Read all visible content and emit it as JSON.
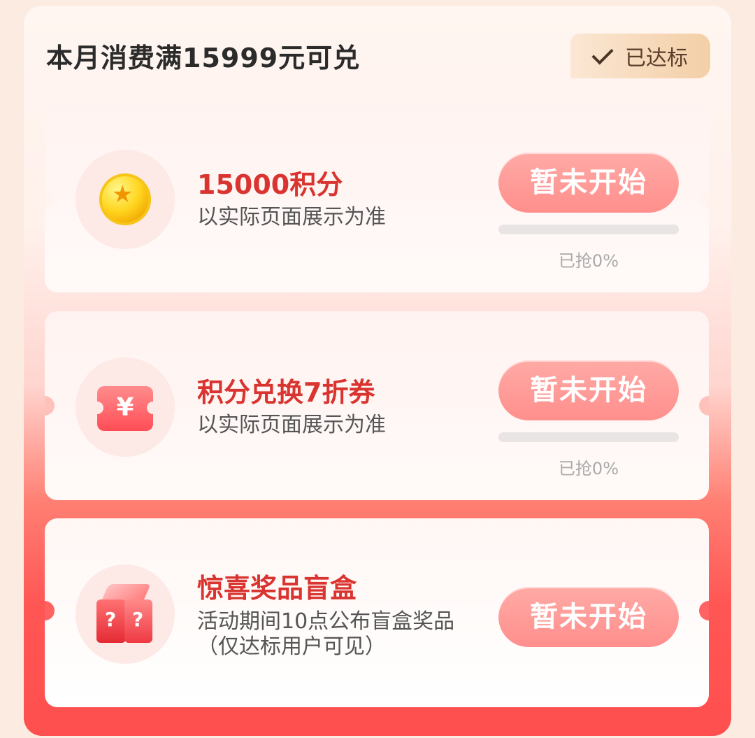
{
  "header": {
    "title": "本月消费满15999元可兑",
    "status_badge": "已达标"
  },
  "rewards": [
    {
      "icon": "coin-icon",
      "title": "15000积分",
      "description": "以实际页面展示为准",
      "button_label": "暂未开始",
      "progress_percent": 0,
      "progress_text": "已抢0%"
    },
    {
      "icon": "coupon-ticket-icon",
      "icon_symbol": "¥",
      "title": "积分兑换7折券",
      "description": "以实际页面展示为准",
      "button_label": "暂未开始",
      "progress_percent": 0,
      "progress_text": "已抢0%"
    },
    {
      "icon": "mystery-box-icon",
      "title": "惊喜奖品盲盒",
      "description": "活动期间10点公布盲盒奖品（仅达标用户可见）",
      "button_label": "暂未开始"
    }
  ],
  "colors": {
    "title_red": "#d9342f",
    "button_pink": "#ff9d99",
    "badge_gold": "#f3cfa6",
    "panel_bottom_red": "#ff4f4f"
  }
}
